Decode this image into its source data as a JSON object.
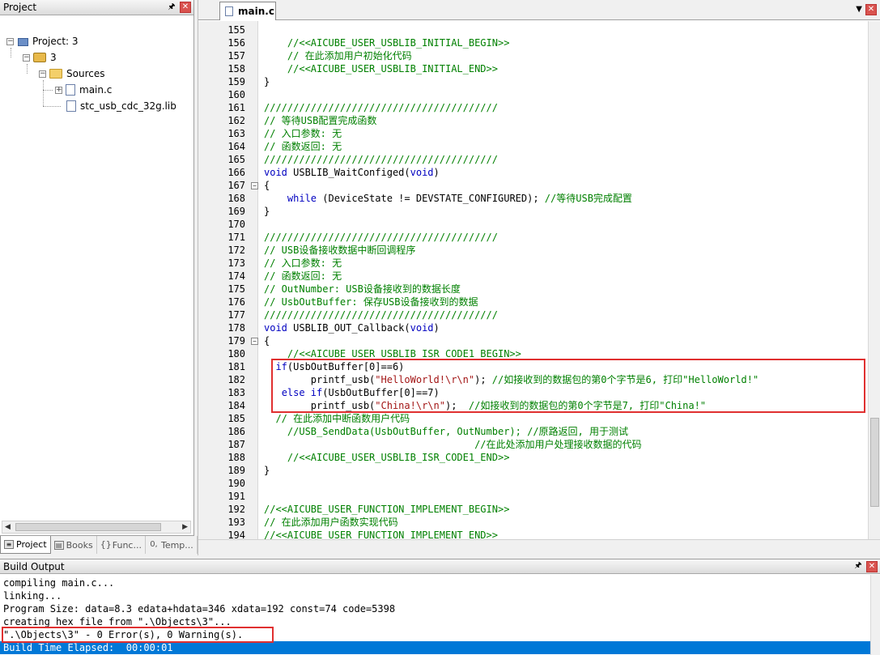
{
  "project_panel": {
    "title": "Project",
    "pin_icon": "pin-icon",
    "close_icon": "close-icon",
    "tree": {
      "root": "Project: 3",
      "target": "3",
      "group": "Sources",
      "files": [
        "main.c",
        "stc_usb_cdc_32g.lib"
      ]
    },
    "tabs": [
      {
        "label": "Project",
        "icon": "project-icon"
      },
      {
        "label": "Books",
        "icon": "books-icon"
      },
      {
        "label": "Func...",
        "icon": "functions-icon"
      },
      {
        "label": "Temp...",
        "icon": "templates-icon"
      }
    ]
  },
  "editor": {
    "tab_label": "main.c",
    "lines": [
      {
        "n": "155",
        "parts": [
          {
            "t": "",
            "c": "pl"
          }
        ]
      },
      {
        "n": "156",
        "parts": [
          {
            "t": "    //<<AICUBE_USER_USBLIB_INITIAL_BEGIN>>",
            "c": "cm"
          }
        ]
      },
      {
        "n": "157",
        "parts": [
          {
            "t": "    // 在此添加用户初始化代码",
            "c": "cm"
          }
        ]
      },
      {
        "n": "158",
        "parts": [
          {
            "t": "    //<<AICUBE_USER_USBLIB_INITIAL_END>>",
            "c": "cm"
          }
        ]
      },
      {
        "n": "159",
        "parts": [
          {
            "t": "}",
            "c": "pl"
          }
        ]
      },
      {
        "n": "160",
        "parts": [
          {
            "t": "",
            "c": "pl"
          }
        ]
      },
      {
        "n": "161",
        "parts": [
          {
            "t": "////////////////////////////////////////",
            "c": "cm"
          }
        ]
      },
      {
        "n": "162",
        "parts": [
          {
            "t": "// 等待USB配置完成函数",
            "c": "cm"
          }
        ]
      },
      {
        "n": "163",
        "parts": [
          {
            "t": "// 入口参数: 无",
            "c": "cm"
          }
        ]
      },
      {
        "n": "164",
        "parts": [
          {
            "t": "// 函数返回: 无",
            "c": "cm"
          }
        ]
      },
      {
        "n": "165",
        "parts": [
          {
            "t": "////////////////////////////////////////",
            "c": "cm"
          }
        ]
      },
      {
        "n": "166",
        "parts": [
          {
            "t": "void",
            "c": "kw"
          },
          {
            "t": " USBLIB_WaitConfiged(",
            "c": "pl"
          },
          {
            "t": "void",
            "c": "kw"
          },
          {
            "t": ")",
            "c": "pl"
          }
        ]
      },
      {
        "n": "167",
        "fold": "-",
        "parts": [
          {
            "t": "{",
            "c": "pl"
          }
        ]
      },
      {
        "n": "168",
        "parts": [
          {
            "t": "    ",
            "c": "pl"
          },
          {
            "t": "while",
            "c": "kw"
          },
          {
            "t": " (DeviceState != DEVSTATE_CONFIGURED); ",
            "c": "pl"
          },
          {
            "t": "//等待USB完成配置",
            "c": "cm"
          }
        ]
      },
      {
        "n": "169",
        "parts": [
          {
            "t": "}",
            "c": "pl"
          }
        ]
      },
      {
        "n": "170",
        "parts": [
          {
            "t": "",
            "c": "pl"
          }
        ]
      },
      {
        "n": "171",
        "parts": [
          {
            "t": "////////////////////////////////////////",
            "c": "cm"
          }
        ]
      },
      {
        "n": "172",
        "parts": [
          {
            "t": "// USB设备接收数据中断回调程序",
            "c": "cm"
          }
        ]
      },
      {
        "n": "173",
        "parts": [
          {
            "t": "// 入口参数: 无",
            "c": "cm"
          }
        ]
      },
      {
        "n": "174",
        "parts": [
          {
            "t": "// 函数返回: 无",
            "c": "cm"
          }
        ]
      },
      {
        "n": "175",
        "parts": [
          {
            "t": "// OutNumber: USB设备接收到的数据长度",
            "c": "cm"
          }
        ]
      },
      {
        "n": "176",
        "parts": [
          {
            "t": "// UsbOutBuffer: 保存USB设备接收到的数据",
            "c": "cm"
          }
        ]
      },
      {
        "n": "177",
        "parts": [
          {
            "t": "////////////////////////////////////////",
            "c": "cm"
          }
        ]
      },
      {
        "n": "178",
        "parts": [
          {
            "t": "void",
            "c": "kw"
          },
          {
            "t": " USBLIB_OUT_Callback(",
            "c": "pl"
          },
          {
            "t": "void",
            "c": "kw"
          },
          {
            "t": ")",
            "c": "pl"
          }
        ]
      },
      {
        "n": "179",
        "fold": "-",
        "parts": [
          {
            "t": "{",
            "c": "pl"
          }
        ]
      },
      {
        "n": "180",
        "parts": [
          {
            "t": "    //<<AICUBE_USER_USBLIB_ISR_CODE1_BEGIN>>",
            "c": "cm"
          }
        ]
      },
      {
        "n": "181",
        "parts": [
          {
            "t": "  ",
            "c": "pl"
          },
          {
            "t": "if",
            "c": "kw"
          },
          {
            "t": "(UsbOutBuffer[0]==6)",
            "c": "pl"
          }
        ]
      },
      {
        "n": "182",
        "parts": [
          {
            "t": "        printf_usb(",
            "c": "pl"
          },
          {
            "t": "\"HelloWorld!\\r\\n\"",
            "c": "str"
          },
          {
            "t": "); ",
            "c": "pl"
          },
          {
            "t": "//如接收到的数据包的第0个字节是6, 打印\"HelloWorld!\"",
            "c": "cm"
          }
        ]
      },
      {
        "n": "183",
        "parts": [
          {
            "t": "   ",
            "c": "pl"
          },
          {
            "t": "else if",
            "c": "kw"
          },
          {
            "t": "(UsbOutBuffer[0]==7)",
            "c": "pl"
          }
        ]
      },
      {
        "n": "184",
        "parts": [
          {
            "t": "        printf_usb(",
            "c": "pl"
          },
          {
            "t": "\"China!\\r\\n\"",
            "c": "str"
          },
          {
            "t": ");  ",
            "c": "pl"
          },
          {
            "t": "//如接收到的数据包的第0个字节是7, 打印\"China!\"",
            "c": "cm"
          }
        ]
      },
      {
        "n": "185",
        "parts": [
          {
            "t": "  // 在此添加中断函数用户代码",
            "c": "cm"
          }
        ]
      },
      {
        "n": "186",
        "parts": [
          {
            "t": "    //USB_SendData(UsbOutBuffer, OutNumber); //原路返回, 用于测试",
            "c": "cm"
          }
        ]
      },
      {
        "n": "187",
        "parts": [
          {
            "t": "                                    //在此处添加用户处理接收数据的代码",
            "c": "cm"
          }
        ]
      },
      {
        "n": "188",
        "parts": [
          {
            "t": "    //<<AICUBE_USER_USBLIB_ISR_CODE1_END>>",
            "c": "cm"
          }
        ]
      },
      {
        "n": "189",
        "parts": [
          {
            "t": "}",
            "c": "pl"
          }
        ]
      },
      {
        "n": "190",
        "parts": [
          {
            "t": "",
            "c": "pl"
          }
        ]
      },
      {
        "n": "191",
        "parts": [
          {
            "t": "",
            "c": "pl"
          }
        ]
      },
      {
        "n": "192",
        "parts": [
          {
            "t": "//<<AICUBE_USER_FUNCTION_IMPLEMENT_BEGIN>>",
            "c": "cm"
          }
        ]
      },
      {
        "n": "193",
        "parts": [
          {
            "t": "// 在此添加用户函数实现代码",
            "c": "cm"
          }
        ]
      },
      {
        "n": "194",
        "parts": [
          {
            "t": "//<<AICUBE_USER_FUNCTION_IMPLEMENT_END>>",
            "c": "cm"
          }
        ]
      }
    ]
  },
  "build_output": {
    "title": "Build Output",
    "lines": [
      "compiling main.c...",
      "linking...",
      "Program Size: data=8.3 edata+hdata=346 xdata=192 const=74 code=5398",
      "creating hex file from \".\\Objects\\3\"...",
      "\".\\Objects\\3\" - 0 Error(s), 0 Warning(s).",
      "Build Time Elapsed:  00:00:01"
    ]
  }
}
